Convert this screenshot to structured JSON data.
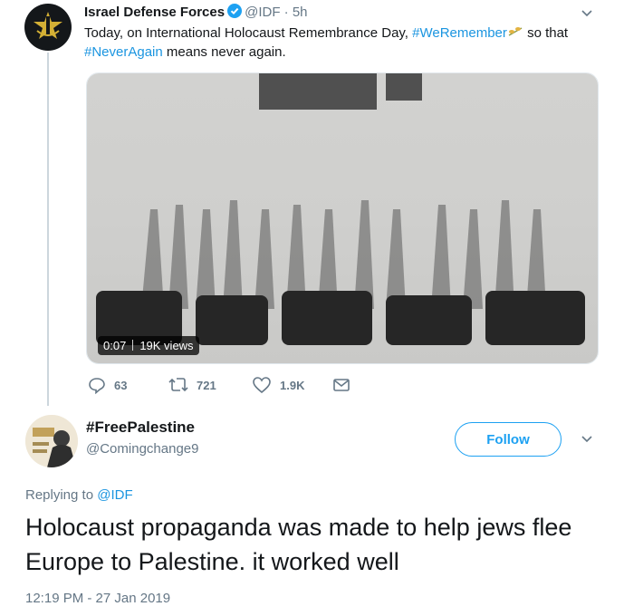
{
  "tweet1": {
    "name": "Israel Defense Forces",
    "handle": "@IDF",
    "time": "· 5h",
    "text_before": "Today, on International Holocaust Remembrance Day, ",
    "hashtag1": "#WeRemember",
    "text_mid": " so that",
    "hashtag2": "#NeverAgain",
    "text_after": " means never again.",
    "video": {
      "duration": "0:07",
      "views": "19K views"
    },
    "actions": {
      "replies": "63",
      "retweets": "721",
      "likes": "1.9K"
    }
  },
  "tweet2": {
    "name": "#FreePalestine",
    "handle": "@Comingchange9",
    "follow_label": "Follow",
    "replying_prefix": "Replying to ",
    "replying_to": "@IDF",
    "text": "Holocaust propaganda was made to help jews flee Europe to Palestine. it worked well",
    "timestamp": "12:19 PM - 27 Jan 2019"
  },
  "colors": {
    "link": "#1b95e0",
    "follow": "#1da1f2",
    "muted": "#657786",
    "text": "#14171a"
  },
  "icons": [
    "verified-icon",
    "chevron-down-icon",
    "reply-icon",
    "retweet-icon",
    "like-icon",
    "dm-icon",
    "idf-logo-icon"
  ]
}
